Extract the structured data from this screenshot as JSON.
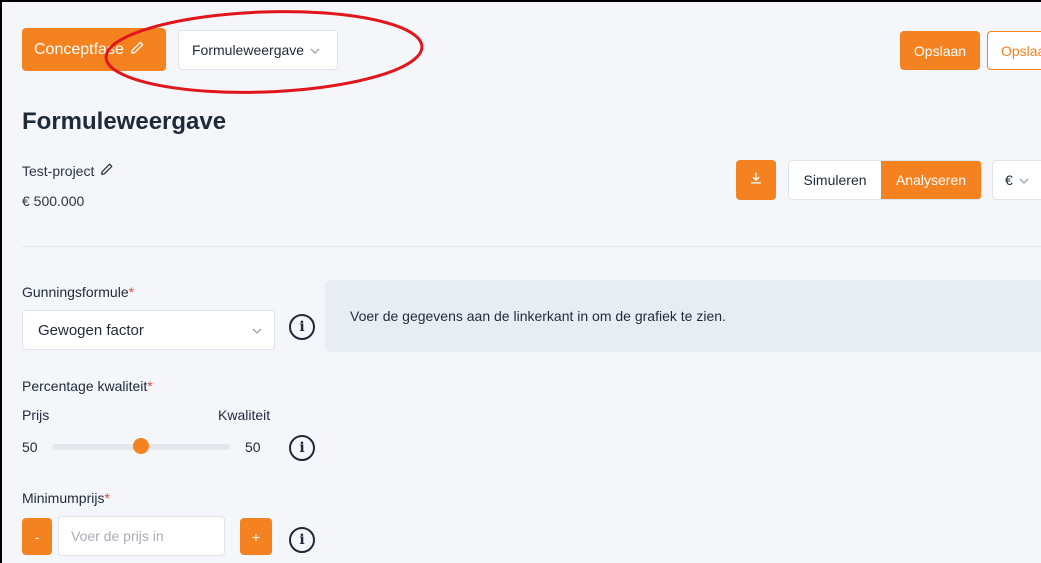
{
  "header": {
    "phase_label": "Conceptfase",
    "view_select_value": "Formuleweergave",
    "save_label": "Opslaan",
    "save_as_label": "Opslaan"
  },
  "page": {
    "title": "Formuleweergave",
    "project_name": "Test-project",
    "project_amount": "€ 500.000"
  },
  "toolbar": {
    "simulate_label": "Simuleren",
    "analyse_label": "Analyseren",
    "currency_value": "€"
  },
  "form": {
    "gunningsformule_label": "Gunningsformule",
    "gunningsformule_value": "Gewogen factor",
    "percentage_label": "Percentage kwaliteit",
    "prijs_label": "Prijs",
    "kwaliteit_label": "Kwaliteit",
    "prijs_value": "50",
    "kwaliteit_value": "50",
    "minimumprijs_label": "Minimumprijs",
    "minimumprijs_placeholder": "Voer de prijs in",
    "required_mark": "*",
    "minus_label": "-",
    "plus_label": "+"
  },
  "chart_panel": {
    "message": "Voer de gegevens aan de linkerkant in om de grafiek te zien."
  },
  "colors": {
    "accent": "#f58220",
    "annotation": "#e0161b"
  },
  "icons": {
    "pencil": "pencil-icon",
    "chevron": "chevron-down-icon",
    "download": "download-icon",
    "info": "info-icon"
  }
}
